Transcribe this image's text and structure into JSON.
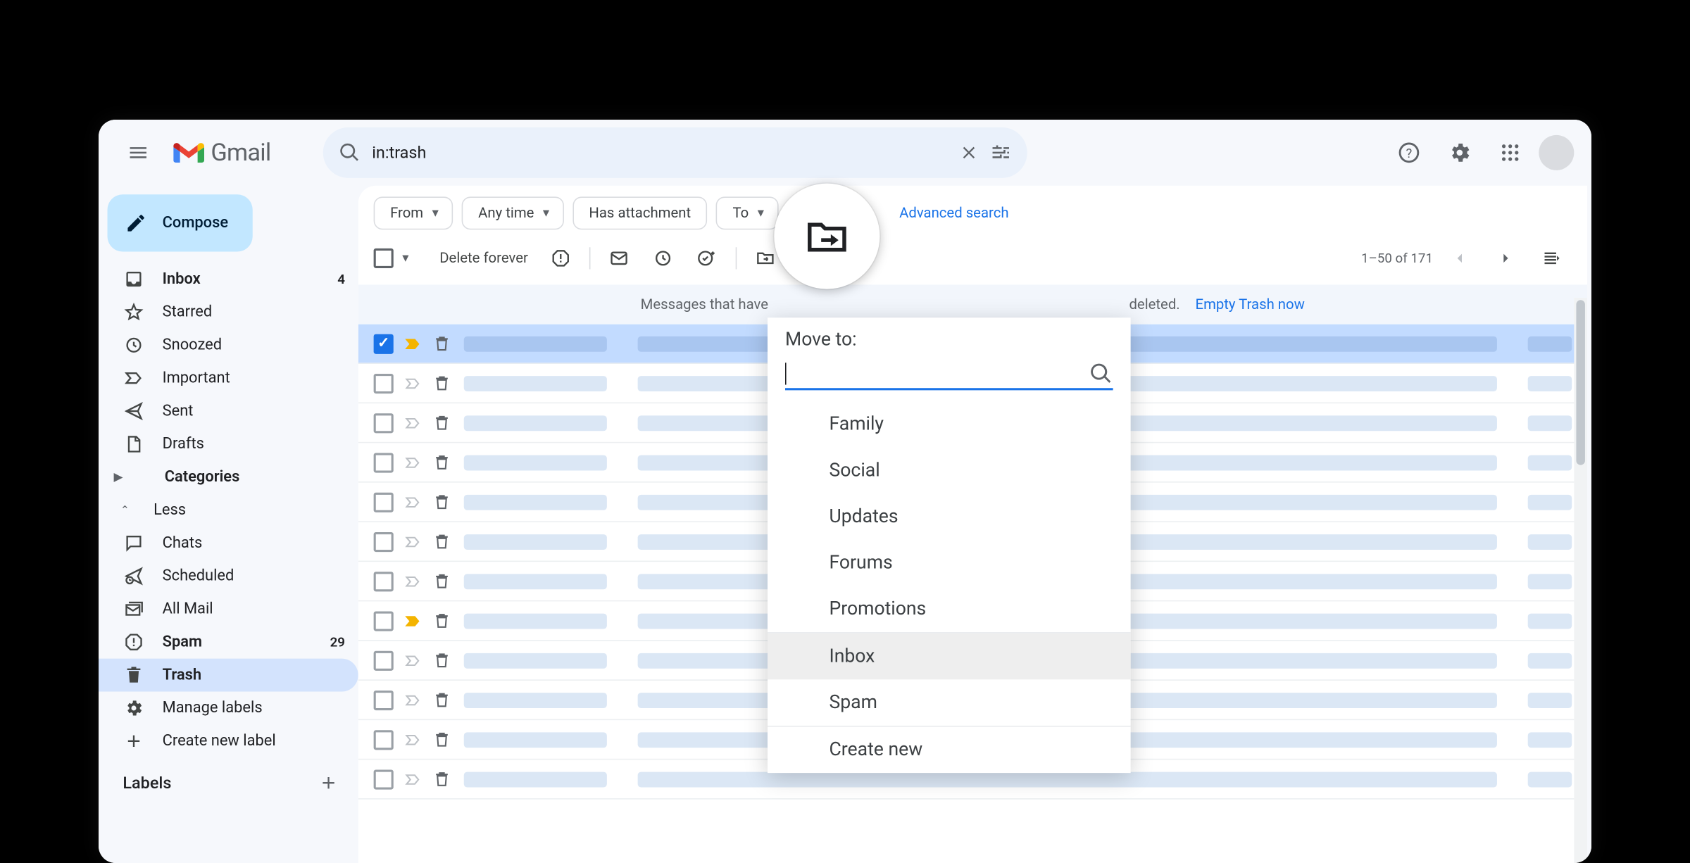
{
  "app": {
    "name": "Gmail"
  },
  "search": {
    "query": "in:trash"
  },
  "compose": {
    "label": "Compose"
  },
  "sidebar": {
    "items": [
      {
        "icon": "inbox",
        "label": "Inbox",
        "count": "4",
        "bold": true
      },
      {
        "icon": "star",
        "label": "Starred"
      },
      {
        "icon": "clock",
        "label": "Snoozed"
      },
      {
        "icon": "important",
        "label": "Important"
      },
      {
        "icon": "send",
        "label": "Sent"
      },
      {
        "icon": "draft",
        "label": "Drafts"
      },
      {
        "icon": "categories",
        "label": "Categories",
        "bold": true,
        "caret": true
      },
      {
        "icon": "less",
        "label": "Less",
        "upcaret": true
      },
      {
        "icon": "chats",
        "label": "Chats"
      },
      {
        "icon": "scheduled",
        "label": "Scheduled"
      },
      {
        "icon": "allmail",
        "label": "All Mail"
      },
      {
        "icon": "spam",
        "label": "Spam",
        "count": "29",
        "bold": true
      },
      {
        "icon": "trash",
        "label": "Trash",
        "active": true
      },
      {
        "icon": "gear",
        "label": "Manage labels"
      },
      {
        "icon": "plus",
        "label": "Create new label"
      }
    ],
    "labels_header": "Labels"
  },
  "filters": {
    "chips": [
      "From",
      "Any time",
      "Has attachment",
      "To"
    ],
    "chip_has_arrow": [
      true,
      true,
      false,
      true
    ],
    "advanced": "Advanced search"
  },
  "toolbar": {
    "delete_forever": "Delete forever",
    "count_text": "1–50 of 171"
  },
  "banner": {
    "text": "Messages that have been in Trash more than 30 days will be automatically deleted.",
    "text_left": "Messages that have",
    "text_right": "deleted.",
    "link": "Empty Trash now"
  },
  "mail_rows": [
    {
      "selected": true,
      "important": true
    },
    {
      "selected": false,
      "important": false
    },
    {
      "selected": false,
      "important": false
    },
    {
      "selected": false,
      "important": false
    },
    {
      "selected": false,
      "important": false
    },
    {
      "selected": false,
      "important": false
    },
    {
      "selected": false,
      "important": false
    },
    {
      "selected": false,
      "important": true
    },
    {
      "selected": false,
      "important": false
    },
    {
      "selected": false,
      "important": false
    },
    {
      "selected": false,
      "important": false
    },
    {
      "selected": false,
      "important": false
    }
  ],
  "move_popover": {
    "title": "Move to:",
    "groups": [
      [
        "Family",
        "Social",
        "Updates",
        "Forums",
        "Promotions"
      ],
      [
        "Inbox",
        "Spam"
      ],
      [
        "Create new"
      ]
    ],
    "highlighted": "Inbox"
  }
}
